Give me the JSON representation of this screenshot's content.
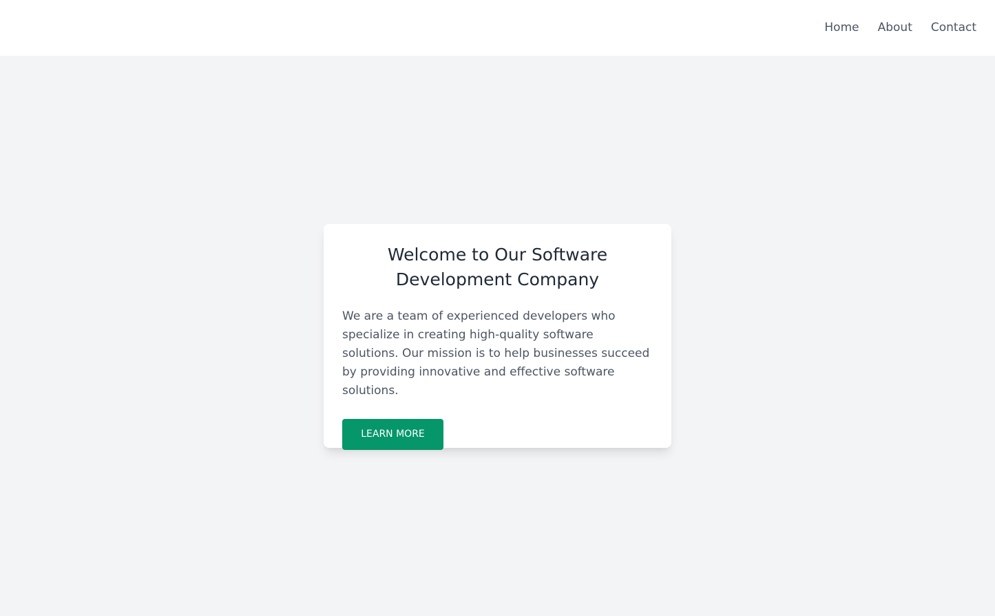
{
  "nav": {
    "items": [
      {
        "label": "Home"
      },
      {
        "label": "About"
      },
      {
        "label": "Contact"
      }
    ]
  },
  "hero": {
    "title": "Welcome to Our Software Development Company",
    "description": "We are a team of experienced developers who specialize in creating high-quality software solutions. Our mission is to help businesses succeed by providing innovative and effective software solutions.",
    "button_label": "LEARN MORE"
  },
  "colors": {
    "background": "#f3f4f6",
    "header": "#ffffff",
    "accent": "#059669",
    "text_primary": "#1f2937",
    "text_secondary": "#4b5563"
  }
}
